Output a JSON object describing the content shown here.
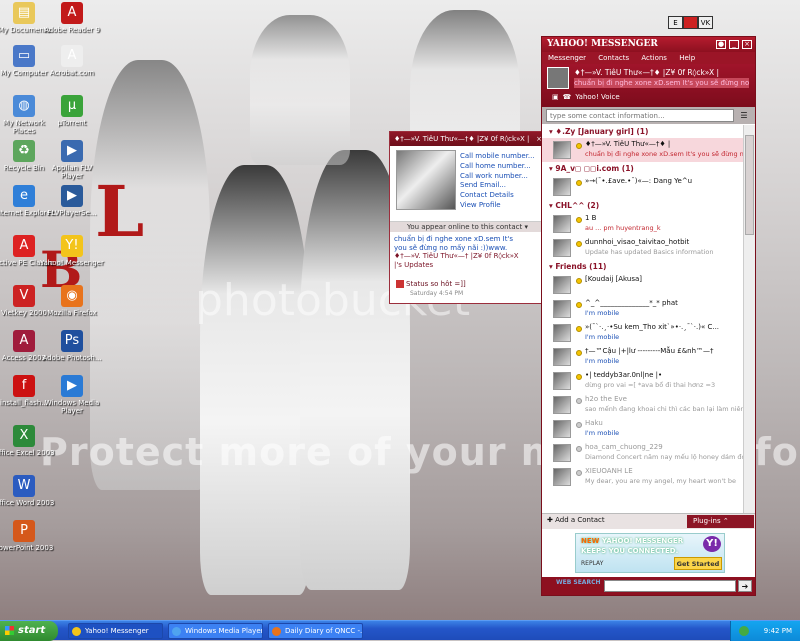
{
  "desktop": {
    "watermark": "Protect more of your memories for less!",
    "watermark_brand": "photobucket",
    "corner_buttons": [
      "E",
      "",
      "VK"
    ],
    "icons": [
      {
        "label": "My Documents",
        "icon": "folder-icon",
        "color": "#e9c85a"
      },
      {
        "label": "Adobe Reader 9",
        "icon": "pdf-icon",
        "color": "#c21a1a"
      },
      {
        "label": "My Computer",
        "icon": "computer-icon",
        "color": "#4a78c8"
      },
      {
        "label": "Acrobat.com",
        "icon": "acrobat-icon",
        "color": "#eeeeee"
      },
      {
        "label": "My Network Places",
        "icon": "network-icon",
        "color": "#4a8ad8"
      },
      {
        "label": "µTorrent",
        "icon": "torrent-icon",
        "color": "#3aa33a"
      },
      {
        "label": "Recycle Bin",
        "icon": "recycle-bin-icon",
        "color": "#5da65d"
      },
      {
        "label": "Applian FLV Player",
        "icon": "flv-icon",
        "color": "#3a6ab0"
      },
      {
        "label": "Internet Explorer",
        "icon": "ie-icon",
        "color": "#2f7fd8"
      },
      {
        "label": "FLVPlayerSe...",
        "icon": "flv-icon",
        "color": "#2a5a9a"
      },
      {
        "label": "Active PE Classic",
        "icon": "active-icon",
        "color": "#d22"
      },
      {
        "label": "Yahoo! Messenger",
        "icon": "yahoo-icon",
        "color": "#f3c41b"
      },
      {
        "label": "Vietkey 2000",
        "icon": "vietkey-icon",
        "color": "#c22"
      },
      {
        "label": "Mozilla Firefox",
        "icon": "firefox-icon",
        "color": "#e8731c"
      },
      {
        "label": "Access 2003",
        "icon": "access-icon",
        "color": "#a01c3c"
      },
      {
        "label": "Adobe Photosh...",
        "icon": "photoshop-icon",
        "color": "#1f4f9e"
      },
      {
        "label": "install_flash...",
        "icon": "flash-icon",
        "color": "#c11"
      },
      {
        "label": "Windows Media Player",
        "icon": "media-player-icon",
        "color": "#2a7ad5"
      },
      {
        "label": "Office Excel 2003",
        "icon": "excel-icon",
        "color": "#2d8a3a"
      },
      {
        "label": "Office Word 2003",
        "icon": "word-icon",
        "color": "#2b5cc0"
      },
      {
        "label": "PowerPoint 2003",
        "icon": "powerpoint-icon",
        "color": "#d5581b"
      }
    ]
  },
  "card": {
    "title": "♦†—»V. TiêU Thư«—†♦ |Z¥ 0f R◊ck»X |",
    "links": [
      "Call mobile number...",
      "Call home number...",
      "Call work number...",
      "Send Email...",
      "Contact Details",
      "View Profile"
    ],
    "online": "You appear online to this contact",
    "status_text": "chuẩn bị đi nghe xone xD.sem It's you sẽ đừng no mấy nãi",
    "status_emoji": ":))",
    "status_suffix": "www.",
    "updates_label": "♦†—»V. TiêU Thư«—† |Z¥ 0f R◊ck»X |'s Updates",
    "plugin_line": "Status so hôt =]]",
    "plugin_time": "Saturday 4:54 PM"
  },
  "messenger": {
    "title_brand": "YAHOO! MESSENGER",
    "menu": [
      "Messenger",
      "Contacts",
      "Actions",
      "Help"
    ],
    "me_name": "♦†—»V. TiêU Thư«—†♦ |Z¥ 0f R◊ck»X |",
    "me_status": "chuẩn bị đi nghe xone xD.sem It's you sẽ đừng no mấy nãi",
    "voice_label": "Yahoo! Voice",
    "search_placeholder": "type some contact information...",
    "groups": [
      {
        "name": "♦.Zy [January girl] (1)",
        "contacts": [
          {
            "name": "♦†—»V. TiêU Thư«—†♦ |",
            "status": "chuẩn bị đi nghe xone xD.sem It's you sẽ đừng no",
            "online": true,
            "style": "sel"
          }
        ]
      },
      {
        "name": "9A_v◻ ◻◻i.com (1)",
        "contacts": [
          {
            "name": "»→(¯•.£ave.•¯)«—: Dang Ye^u",
            "status": "",
            "online": true,
            "style": ""
          }
        ]
      },
      {
        "name": "CHL^^ (2)",
        "contacts": [
          {
            "name": "1 B",
            "status": "au ... pm huyentrang_k",
            "online": true,
            "style": ""
          },
          {
            "name": "dunnhoi_visao_taivitao_hotbit",
            "status": "Update  has updated Basics information",
            "online": true,
            "style": "grey"
          }
        ]
      },
      {
        "name": "Friends (11)",
        "contacts": [
          {
            "name": "[Koudaij [Akusa]",
            "status": "",
            "online": true,
            "style": ""
          },
          {
            "name": "^_^______________*_* phat",
            "status": "I'm mobile",
            "online": true,
            "style": "mob"
          },
          {
            "name": "»(¯`·.¸·•Su kem_Tho xit`»•·.¸¯`·.)« C...",
            "status": "I'm mobile",
            "online": true,
            "style": "mob"
          },
          {
            "name": "†—™Cậu |+|lư ---------Mẫu £&nh™—†",
            "status": "I'm mobile",
            "online": true,
            "style": "mob"
          },
          {
            "name": "•| teddyb3ar.0nl|ne |•",
            "status": "dừng pro vai =[ *ava bổ đi thai hơnz =3",
            "online": true,
            "style": "grey"
          },
          {
            "name": "h2o the Eve",
            "status": "sao mếnh đang khoai chi thì các ban lại làm niên",
            "online": false,
            "style": "grey"
          },
          {
            "name": "Haku",
            "status": "I'm mobile",
            "online": false,
            "style": "mob"
          },
          {
            "name": "hoa_cam_chuong_229",
            "status": "Diamond Concert năm nay mếu lộ honey dám đợi",
            "online": false,
            "style": "grey"
          },
          {
            "name": "XIEUOANH LE",
            "status": "My dear, you are my angel, my heart won't be",
            "online": false,
            "style": "grey"
          }
        ]
      }
    ],
    "add_contact": "Add a Contact",
    "plugins": "Plug-ins",
    "ad_new": "NEW",
    "ad_line1": "YAHOO! MESSENGER",
    "ad_line2": "KEEPS YOU CONNECTED.",
    "ad_replay": "REPLAY",
    "ad_button": "Get Started",
    "web_search_label": "WEB SEARCH"
  },
  "taskbar": {
    "start": "start",
    "tasks": [
      "Yahoo! Messenger",
      "Windows Media Player",
      "Daily Diary of QNCC -..."
    ],
    "clock": "9:42 PM"
  }
}
